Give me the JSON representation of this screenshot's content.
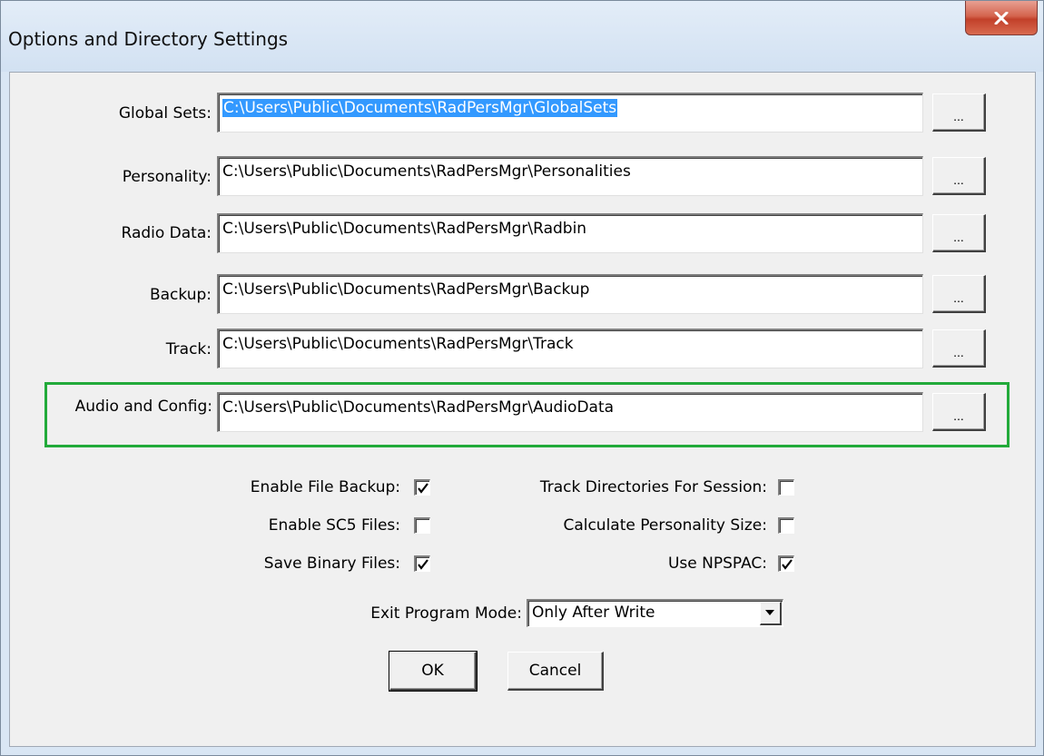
{
  "window": {
    "title": "Options and Directory Settings",
    "close_icon": "close-icon"
  },
  "directories": [
    {
      "label": "Global Sets:",
      "path": "C:\\Users\\Public\\Documents\\RadPersMgr\\GlobalSets",
      "browse": "..."
    },
    {
      "label": "Personality:",
      "path": "C:\\Users\\Public\\Documents\\RadPersMgr\\Personalities",
      "browse": "..."
    },
    {
      "label": "Radio Data:",
      "path": "C:\\Users\\Public\\Documents\\RadPersMgr\\Radbin",
      "browse": "..."
    },
    {
      "label": "Backup:",
      "path": "C:\\Users\\Public\\Documents\\RadPersMgr\\Backup",
      "browse": "..."
    },
    {
      "label": "Track:",
      "path": "C:\\Users\\Public\\Documents\\RadPersMgr\\Track",
      "browse": "..."
    },
    {
      "label": "Audio and Config:",
      "path": "C:\\Users\\Public\\Documents\\RadPersMgr\\AudioData",
      "browse": "..."
    }
  ],
  "options": {
    "enable_file_backup": {
      "label": "Enable File Backup:",
      "checked": true
    },
    "enable_sc5_files": {
      "label": "Enable SC5 Files:",
      "checked": false
    },
    "save_binary_files": {
      "label": "Save Binary Files:",
      "checked": true
    },
    "track_directories": {
      "label": "Track Directories For Session:",
      "checked": false
    },
    "calculate_size": {
      "label": "Calculate Personality Size:",
      "checked": false
    },
    "use_npspac": {
      "label": "Use NPSPAC:",
      "checked": true
    }
  },
  "exit_mode": {
    "label": "Exit Program Mode:",
    "value": "Only After Write"
  },
  "buttons": {
    "ok": "OK",
    "cancel": "Cancel"
  },
  "colors": {
    "highlight_box": "#22aa3a",
    "selection": "#3399ff",
    "close_button": "#c2402a"
  }
}
